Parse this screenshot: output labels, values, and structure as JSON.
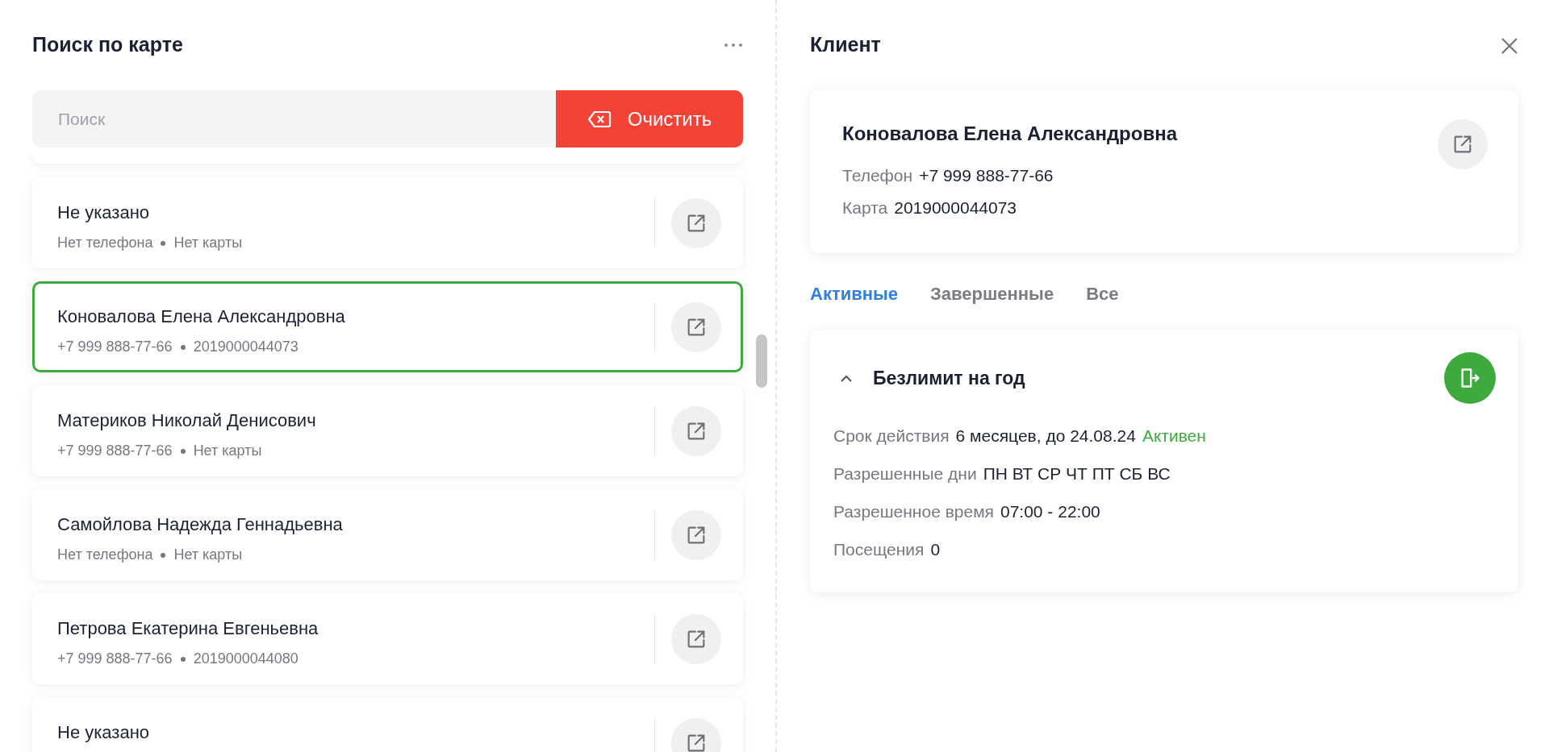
{
  "left_panel": {
    "title": "Поиск по карте",
    "search": {
      "placeholder": "Поиск"
    },
    "clear_button": "Очистить",
    "clients": [
      {
        "name": "Не указано",
        "phone": "Нет телефона",
        "card": "Нет карты",
        "selected": false
      },
      {
        "name": "Коновалова Елена Александровна",
        "phone": "+7 999 888-77-66",
        "card": "2019000044073",
        "selected": true
      },
      {
        "name": "Материков Николай Денисович",
        "phone": "+7 999 888-77-66",
        "card": "Нет карты",
        "selected": false
      },
      {
        "name": "Самойлова Надежда Геннадьевна",
        "phone": "Нет телефона",
        "card": "Нет карты",
        "selected": false
      },
      {
        "name": "Петрова Екатерина Евгеньевна",
        "phone": "+7 999 888-77-66",
        "card": "2019000044080",
        "selected": false
      },
      {
        "name": "Не указано",
        "selected": false
      }
    ]
  },
  "right_panel": {
    "title": "Клиент",
    "client": {
      "name": "Коновалова Елена Александровна",
      "fields": [
        {
          "label": "Телефон",
          "value": "+7 999 888-77-66"
        },
        {
          "label": "Карта",
          "value": "2019000044073"
        }
      ]
    },
    "tabs": [
      {
        "label": "Активные",
        "selected": true
      },
      {
        "label": "Завершенные",
        "selected": false
      },
      {
        "label": "Все",
        "selected": false
      }
    ],
    "subscriptions": [
      {
        "title": "Безлимит на год",
        "expanded": true,
        "fields": [
          {
            "label": "Срок действия",
            "value": "6 месяцев, до 24.08.24",
            "status": "Активен"
          },
          {
            "label": "Разрешенные дни",
            "value": "ПН ВТ СР ЧТ ПТ СБ ВС"
          },
          {
            "label": "Разрешенное время",
            "value": "07:00 - 22:00"
          },
          {
            "label": "Посещения",
            "value": "0"
          }
        ]
      }
    ]
  }
}
